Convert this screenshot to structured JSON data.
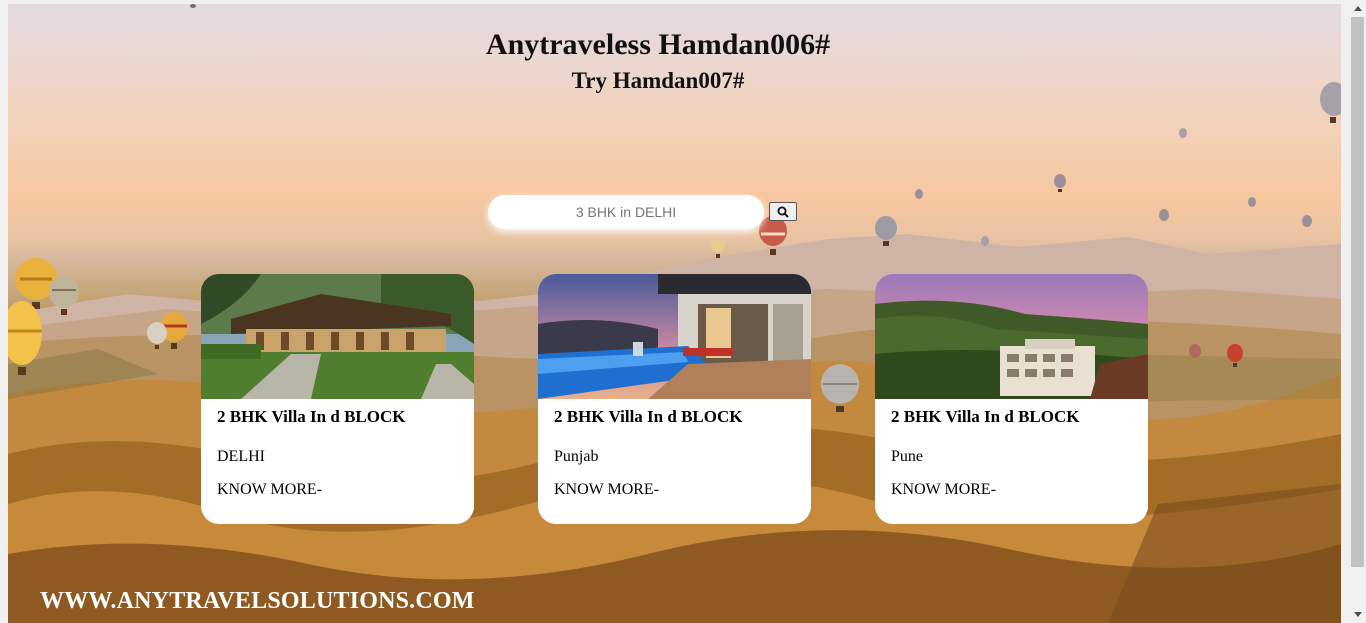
{
  "header": {
    "title": "Anytraveless Hamdan006#",
    "subtitle": "Try Hamdan007#"
  },
  "search": {
    "placeholder": "3 BHK in DELHI",
    "button_icon": "search-icon"
  },
  "cards": [
    {
      "title": "2 BHK Villa In d BLOCK",
      "location": "DELHI",
      "link": "KNOW MORE-",
      "image": "villa-garden-photo"
    },
    {
      "title": "2 BHK Villa In d BLOCK",
      "location": "Punjab",
      "link": "KNOW MORE-",
      "image": "villa-pool-photo"
    },
    {
      "title": "2 BHK Villa In d BLOCK",
      "location": "Pune",
      "link": "KNOW MORE-",
      "image": "villa-hillside-photo"
    }
  ],
  "footer": {
    "website": "WWW.ANYTRAVELSOLUTIONS.COM"
  },
  "colors": {
    "card_bg": "#ffffff",
    "footer_text": "#ffffff",
    "title_text": "#111111"
  }
}
